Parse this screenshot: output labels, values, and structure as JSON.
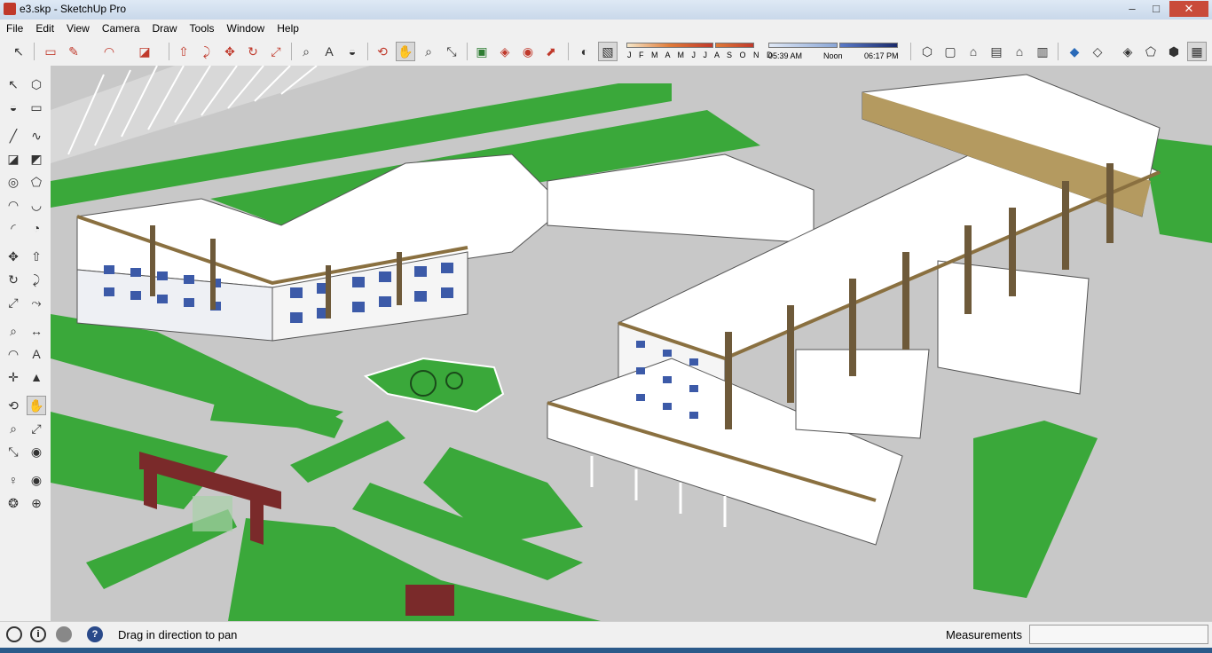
{
  "window": {
    "title": "e3.skp - SketchUp Pro",
    "minimize_glyph": "–",
    "maximize_glyph": "□",
    "close_glyph": "✕"
  },
  "menu": [
    "File",
    "Edit",
    "View",
    "Camera",
    "Draw",
    "Tools",
    "Window",
    "Help"
  ],
  "toolbar": {
    "tools": [
      {
        "name": "select-icon",
        "glyph": "↖"
      },
      {
        "name": "eraser-icon",
        "glyph": "▭"
      },
      {
        "name": "pencil-icon",
        "glyph": "✎"
      },
      {
        "name": "arc-icon",
        "glyph": "◠"
      },
      {
        "name": "rectangle-icon",
        "glyph": "◪"
      },
      {
        "name": "push-pull-icon",
        "glyph": "⇧"
      },
      {
        "name": "follow-me-icon",
        "glyph": "⤸"
      },
      {
        "name": "move-icon",
        "glyph": "✥"
      },
      {
        "name": "rotate-icon",
        "glyph": "↻"
      },
      {
        "name": "scale-icon",
        "glyph": "⤢"
      },
      {
        "name": "tape-measure-icon",
        "glyph": "⌕"
      },
      {
        "name": "text-icon",
        "glyph": "A"
      },
      {
        "name": "paint-bucket-icon",
        "glyph": "◒"
      },
      {
        "name": "orbit-icon",
        "glyph": "⟲"
      },
      {
        "name": "pan-icon",
        "glyph": "✋"
      },
      {
        "name": "zoom-icon",
        "glyph": "⌕"
      },
      {
        "name": "zoom-extents-icon",
        "glyph": "⤡"
      },
      {
        "name": "warehouse-icon",
        "glyph": "▣"
      },
      {
        "name": "share-model-icon",
        "glyph": "◈"
      },
      {
        "name": "get-components-icon",
        "glyph": "◉"
      },
      {
        "name": "extension-icon",
        "glyph": "⬈"
      },
      {
        "name": "shadows-icon",
        "glyph": "◐"
      },
      {
        "name": "fog-icon",
        "glyph": "▧"
      }
    ],
    "months_label": "J F M A M J J A S O N D",
    "time_start": "05:39 AM",
    "time_mid": "Noon",
    "time_end": "06:17 PM",
    "view_tools": [
      {
        "name": "iso-view-icon",
        "glyph": "⬡"
      },
      {
        "name": "top-view-icon",
        "glyph": "▢"
      },
      {
        "name": "front-view-icon",
        "glyph": "⌂"
      },
      {
        "name": "right-view-icon",
        "glyph": "▤"
      },
      {
        "name": "back-view-icon",
        "glyph": "⌂"
      },
      {
        "name": "left-view-icon",
        "glyph": "▥"
      },
      {
        "name": "xray-icon",
        "glyph": "◆"
      },
      {
        "name": "wireframe-icon",
        "glyph": "◇"
      },
      {
        "name": "hidden-line-icon",
        "glyph": "◈"
      },
      {
        "name": "shaded-icon",
        "glyph": "⬠"
      },
      {
        "name": "shaded-textures-icon",
        "glyph": "⬢"
      },
      {
        "name": "monochrome-icon",
        "glyph": "▦"
      }
    ]
  },
  "left_toolbar": [
    {
      "name": "select-icon",
      "glyph": "↖"
    },
    {
      "name": "make-component-icon",
      "glyph": "⬡"
    },
    {
      "name": "paint-bucket-icon",
      "glyph": "◒"
    },
    {
      "name": "eraser-icon",
      "glyph": "▭"
    },
    {
      "name": "line-icon",
      "glyph": "╱"
    },
    {
      "name": "freehand-icon",
      "glyph": "∿"
    },
    {
      "name": "rectangle-icon",
      "glyph": "◪"
    },
    {
      "name": "rotated-rectangle-icon",
      "glyph": "◩"
    },
    {
      "name": "circle-icon",
      "glyph": "◎"
    },
    {
      "name": "polygon-icon",
      "glyph": "⬠"
    },
    {
      "name": "arc-icon",
      "glyph": "◠"
    },
    {
      "name": "two-point-arc-icon",
      "glyph": "◡"
    },
    {
      "name": "three-point-arc-icon",
      "glyph": "◜"
    },
    {
      "name": "pie-icon",
      "glyph": "◔"
    },
    {
      "name": "move-icon",
      "glyph": "✥"
    },
    {
      "name": "push-pull-icon",
      "glyph": "⇧"
    },
    {
      "name": "rotate-icon",
      "glyph": "↻"
    },
    {
      "name": "follow-me-icon",
      "glyph": "⤸"
    },
    {
      "name": "scale-icon",
      "glyph": "⤢"
    },
    {
      "name": "offset-icon",
      "glyph": "⤳"
    },
    {
      "name": "tape-measure-icon",
      "glyph": "⌕"
    },
    {
      "name": "dimension-icon",
      "glyph": "↔"
    },
    {
      "name": "protractor-icon",
      "glyph": "◠"
    },
    {
      "name": "text-icon",
      "glyph": "A"
    },
    {
      "name": "axes-icon",
      "glyph": "✛"
    },
    {
      "name": "3d-text-icon",
      "glyph": "▲"
    },
    {
      "name": "orbit-icon",
      "glyph": "⟲"
    },
    {
      "name": "pan-icon",
      "glyph": "✋"
    },
    {
      "name": "zoom-icon",
      "glyph": "⌕"
    },
    {
      "name": "zoom-window-icon",
      "glyph": "⤢"
    },
    {
      "name": "zoom-extents-icon",
      "glyph": "⤡"
    },
    {
      "name": "previous-view-icon",
      "glyph": "◉"
    },
    {
      "name": "position-camera-icon",
      "glyph": "♀"
    },
    {
      "name": "look-around-icon",
      "glyph": "◉"
    },
    {
      "name": "walk-icon",
      "glyph": "❂"
    },
    {
      "name": "section-plane-icon",
      "glyph": "⊕"
    }
  ],
  "status": {
    "message": "Drag in direction to pan",
    "measurements_label": "Measurements",
    "measurements_value": "",
    "help_glyph": "?",
    "info_glyph": "i"
  },
  "colors": {
    "grass": "#3aa83a",
    "pavement": "#c8c8c8",
    "roof": "#ffffff",
    "wall_trim": "#8a7040",
    "window": "#3c5aa8",
    "gate": "#7a2a2a"
  }
}
